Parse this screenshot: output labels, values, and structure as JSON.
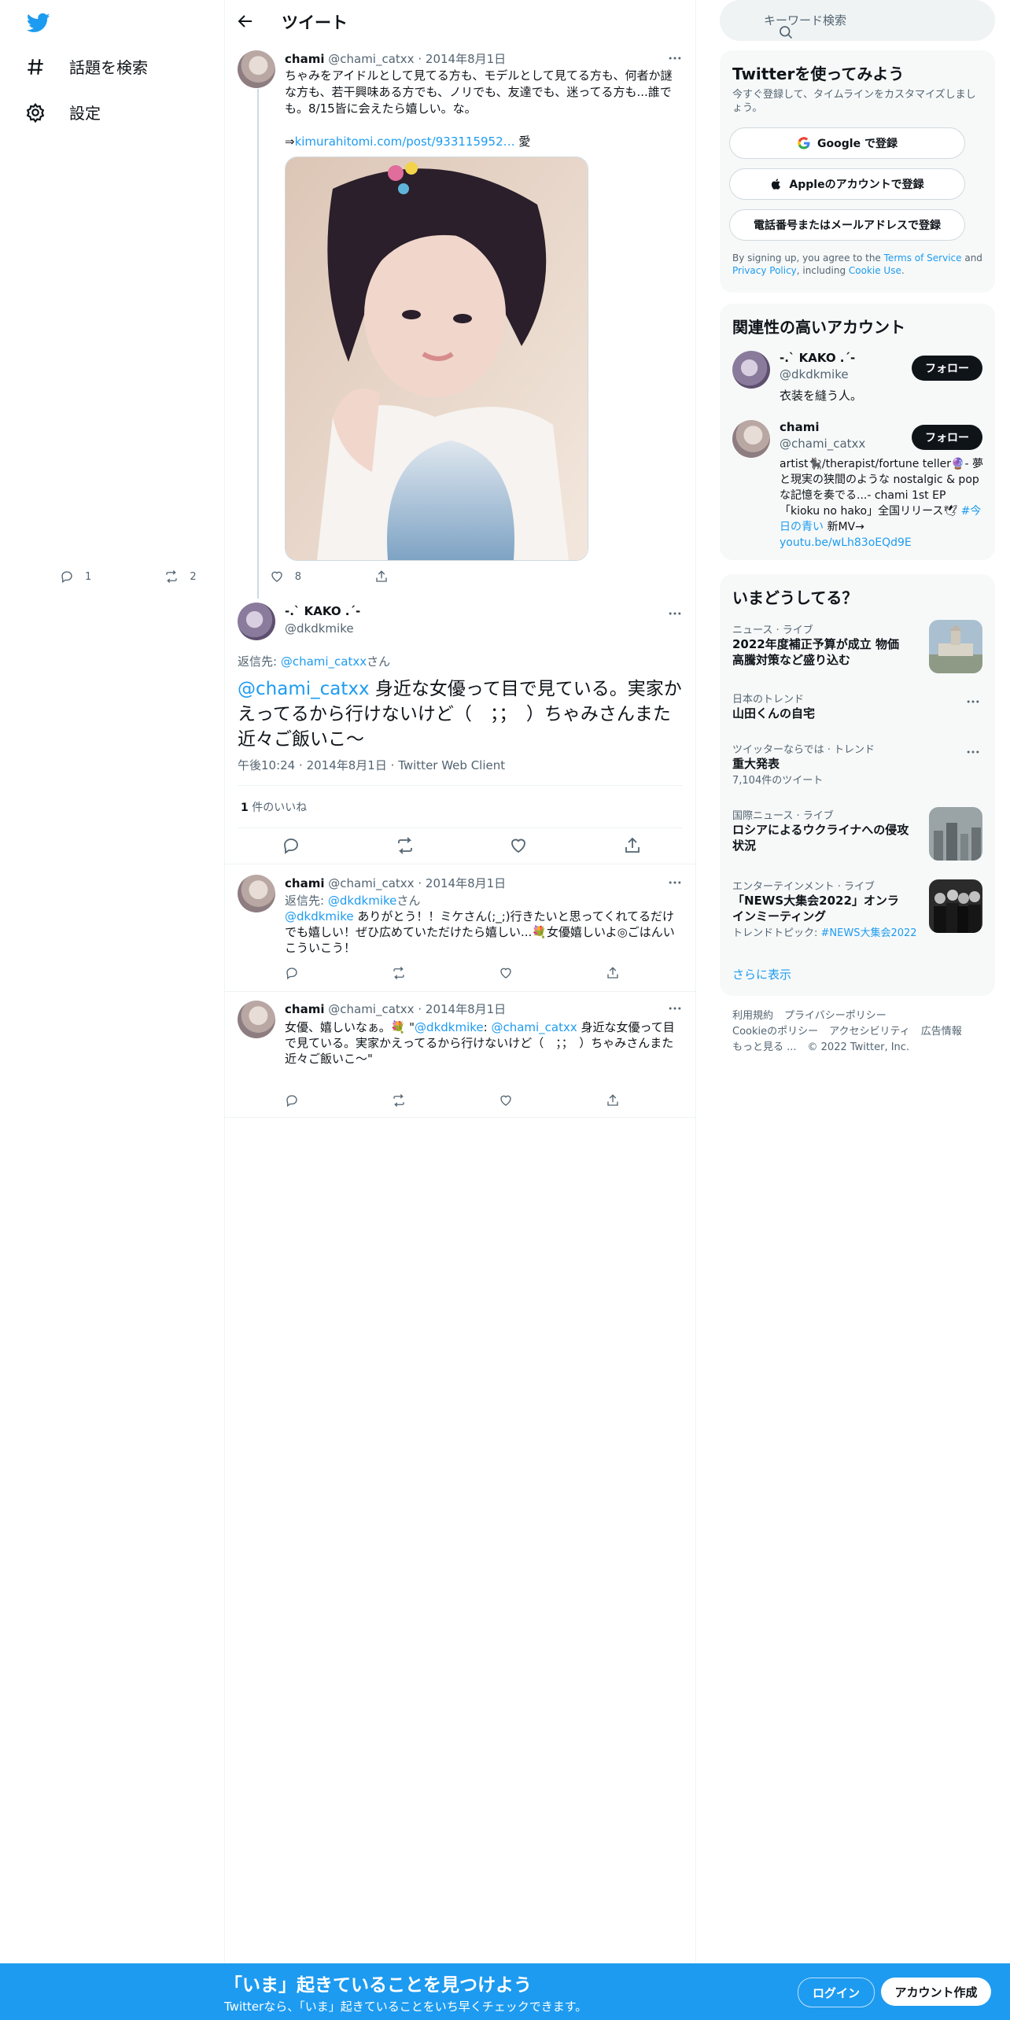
{
  "nav": {
    "explore_label": "話題を検索",
    "settings_label": "設定"
  },
  "header": {
    "title": "ツイート"
  },
  "tweet1": {
    "name": "chami",
    "handle": "@chami_catxx",
    "sep": "·",
    "date": "2014年8月1日",
    "text": "ちゃみをアイドルとして見てる方も、モデルとして見てる方も、何者か謎な方も、若干興味ある方でも、ノリでも、友達でも、迷ってる方も...誰でも。8/15皆に会えたら嬉しい。な。",
    "arrow": "⇒",
    "link": "kimurahitomi.com/post/933115952…",
    "trail": " 愛",
    "replies": "1",
    "retweets": "2",
    "likes": "8"
  },
  "main_tweet": {
    "name": "-.` KAKO .´-",
    "handle": "@dkdkmike",
    "reply_prefix": "返信先: ",
    "reply_to": "@chami_catxx",
    "reply_suffix": "さん",
    "mention": "@chami_catxx",
    "text": " 身近な女優って目で見ている。実家かえってるから行けないけど（　；；　）ちゃみさんまた近々ご飯いこ〜",
    "time": "午後10:24",
    "sep": "·",
    "date": "2014年8月1日",
    "client": "Twitter Web Client",
    "likes_count": "1",
    "likes_label": " 件のいいね"
  },
  "reply1": {
    "name": "chami",
    "handle": "@chami_catxx",
    "sep": "·",
    "date": "2014年8月1日",
    "reply_prefix": "返信先: ",
    "reply_to": "@dkdkmike",
    "reply_suffix": "さん",
    "mention": "@dkdkmike",
    "text": " ありがとう！！ミケさん(;_;)行きたいと思ってくれてるだけでも嬉しい！ぜひ広めていただけたら嬉しい...💐女優嬉しいよ◎ごはんいこういこう！"
  },
  "reply2": {
    "name": "chami",
    "handle": "@chami_catxx",
    "sep": "·",
    "date": "2014年8月1日",
    "text_a": "女優、嬉しいなぁ。💐 \"",
    "mention_a": "@dkdkmike",
    "text_b": ": ",
    "mention_b": "@chami_catxx",
    "text_c": " 身近な女優って目で見ている。実家かえってるから行けないけど（　；；　）ちゃみさんまた近々ご飯いこ〜\""
  },
  "search": {
    "placeholder": "キーワード検索"
  },
  "signup_card": {
    "title": "Twitterを使ってみよう",
    "subtitle": "今すぐ登録して、タイムラインをカスタマイズしましょう。",
    "google": "Google で登録",
    "apple": "Appleのアカウントで登録",
    "phone": "電話番号またはメールアドレスで登録",
    "legal_a": "By signing up, you agree to the ",
    "tos": "Terms of Service",
    "legal_b": " and ",
    "privacy": "Privacy Policy",
    "legal_c": ", including ",
    "cookie": "Cookie Use",
    "legal_d": "."
  },
  "related": {
    "title": "関連性の高いアカウント",
    "follow_label": "フォロー",
    "accounts": [
      {
        "name": "-.` KAKO .´-",
        "handle": "@dkdkmike",
        "bio": "衣装を縫う人。"
      },
      {
        "name": "chami",
        "handle": "@chami_catxx",
        "bio": "artist🐈‍⬛/therapist/fortune teller🔮- 夢と現実の狭間のような nostalgic & popな記憶を奏でる...- chami 1st EP「kioku no hako」全国リリース🕊",
        "hashtag": "#今日の青い",
        "bio_b": " 新MV→ ",
        "link": "youtu.be/wLh83oEQd9E"
      }
    ]
  },
  "trends": {
    "title": "いまどうしてる？",
    "items": [
      {
        "category": "ニュース · ライブ",
        "title": "2022年度補正予算が成立 物価高騰対策など盛り込む"
      },
      {
        "category": "日本のトレンド",
        "title": "山田くんの自宅"
      },
      {
        "category": "ツイッターならでは · トレンド",
        "title": "重大発表",
        "sub": "7,104件のツイート"
      },
      {
        "category": "国際ニュース · ライブ",
        "title": "ロシアによるウクライナへの侵攻状況"
      },
      {
        "category": "エンターテインメント · ライブ",
        "title": "「NEWS大集会2022」オンラインミーティング",
        "sub_prefix": "トレンドトピック: ",
        "sub_link": "#NEWS大集会2022"
      }
    ],
    "show_more": "さらに表示"
  },
  "footer": {
    "terms": "利用規約",
    "privacy": "プライバシーポリシー",
    "cookie": "Cookieのポリシー",
    "accessibility": "アクセシビリティ",
    "ads": "広告情報",
    "more": "もっと見る ...",
    "copyright": "© 2022 Twitter, Inc."
  },
  "bottom_bar": {
    "headline": "「いま」起きていることを見つけよう",
    "subline": "Twitterなら、「いま」起きていることをいち早くチェックできます。",
    "login": "ログイン",
    "signup": "アカウント作成"
  },
  "colors": {
    "accent": "#1d9bf0",
    "text": "#0f1419",
    "muted": "#536471",
    "border": "#eff3f4"
  }
}
